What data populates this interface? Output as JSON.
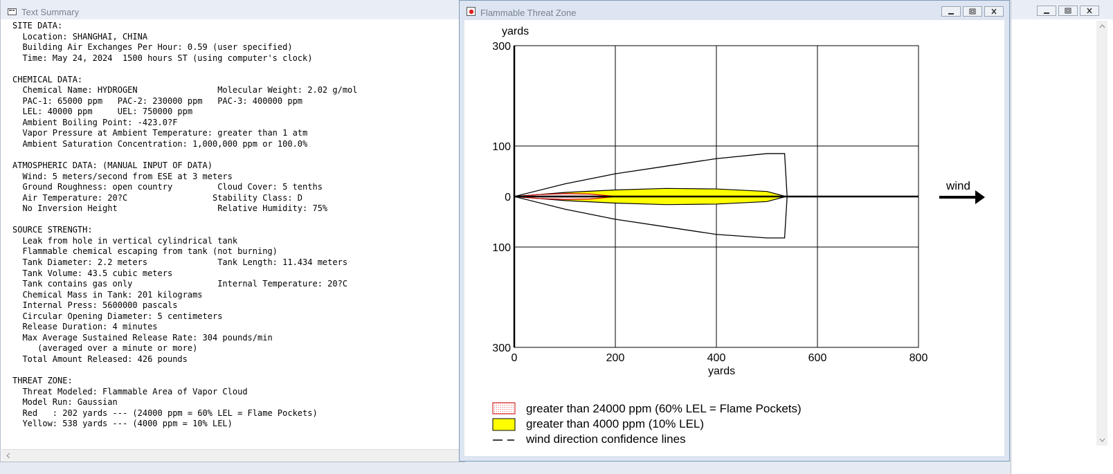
{
  "text_summary": {
    "title": "Text Summary",
    "lines": [
      "SITE DATA:",
      "  Location: SHANGHAI, CHINA",
      "  Building Air Exchanges Per Hour: 0.59 (user specified)",
      "  Time: May 24, 2024  1500 hours ST (using computer's clock)",
      "",
      "CHEMICAL DATA:",
      "  Chemical Name: HYDROGEN                Molecular Weight: 2.02 g/mol",
      "  PAC-1: 65000 ppm   PAC-2: 230000 ppm   PAC-3: 400000 ppm",
      "  LEL: 40000 ppm     UEL: 750000 ppm",
      "  Ambient Boiling Point: -423.0?F",
      "  Vapor Pressure at Ambient Temperature: greater than 1 atm",
      "  Ambient Saturation Concentration: 1,000,000 ppm or 100.0%",
      "",
      "ATMOSPHERIC DATA: (MANUAL INPUT OF DATA)",
      "  Wind: 5 meters/second from ESE at 3 meters",
      "  Ground Roughness: open country         Cloud Cover: 5 tenths",
      "  Air Temperature: 20?C                 Stability Class: D",
      "  No Inversion Height                    Relative Humidity: 75%",
      "",
      "SOURCE STRENGTH:",
      "  Leak from hole in vertical cylindrical tank",
      "  Flammable chemical escaping from tank (not burning)",
      "  Tank Diameter: 2.2 meters              Tank Length: 11.434 meters",
      "  Tank Volume: 43.5 cubic meters",
      "  Tank contains gas only                 Internal Temperature: 20?C",
      "  Chemical Mass in Tank: 201 kilograms",
      "  Internal Press: 5600000 pascals",
      "  Circular Opening Diameter: 5 centimeters",
      "  Release Duration: 4 minutes",
      "  Max Average Sustained Release Rate: 304 pounds/min",
      "     (averaged over a minute or more)",
      "  Total Amount Released: 426 pounds",
      "",
      "THREAT ZONE:",
      "  Threat Modeled: Flammable Area of Vapor Cloud",
      "  Model Run: Gaussian",
      "  Red   : 202 yards --- (24000 ppm = 60% LEL = Flame Pockets)",
      "  Yellow: 538 yards --- (4000 ppm = 10% LEL)"
    ]
  },
  "threat_window": {
    "title": "Flammable Threat Zone",
    "wind_label": "wind",
    "legend": [
      {
        "label": "greater than 24000 ppm (60% LEL = Flame Pockets)",
        "swatch": "red-dotted"
      },
      {
        "label": "greater than 4000 ppm (10% LEL)",
        "swatch": "yellow"
      },
      {
        "label": "wind direction confidence lines",
        "swatch": "dashed-line"
      }
    ]
  },
  "chart_data": {
    "type": "area",
    "xlabel": "yards",
    "ylabel": "yards",
    "xlim": [
      0,
      800
    ],
    "ylim": [
      -300,
      300
    ],
    "x_ticks": [
      "0",
      "200",
      "400",
      "600",
      "800"
    ],
    "y_ticks": [
      "300",
      "100",
      "0",
      "100",
      "300"
    ],
    "y_tick_values": [
      300,
      100,
      0,
      -100,
      -300
    ],
    "grid": true,
    "series": [
      {
        "name": "greater than 24000 ppm (60% LEL = Flame Pockets)",
        "color": "#cc0000",
        "x": [
          0,
          50,
          100,
          150,
          202
        ],
        "half_width": [
          0,
          4,
          6,
          5,
          0
        ]
      },
      {
        "name": "greater than 4000 ppm (10% LEL)",
        "color": "#ffff00",
        "x": [
          0,
          100,
          200,
          300,
          400,
          500,
          538
        ],
        "half_width": [
          0,
          8,
          13,
          16,
          15,
          10,
          0
        ]
      },
      {
        "name": "wind direction confidence lines",
        "color": "#000000",
        "x": [
          0,
          100,
          200,
          300,
          400,
          500,
          535,
          540
        ],
        "upper": [
          0,
          25,
          45,
          60,
          75,
          85,
          85,
          0
        ],
        "lower": [
          0,
          -25,
          -45,
          -60,
          -75,
          -82,
          -82,
          0
        ]
      }
    ]
  },
  "right_window": {
    "scroll_up": "▲",
    "scroll_down": "▼"
  }
}
